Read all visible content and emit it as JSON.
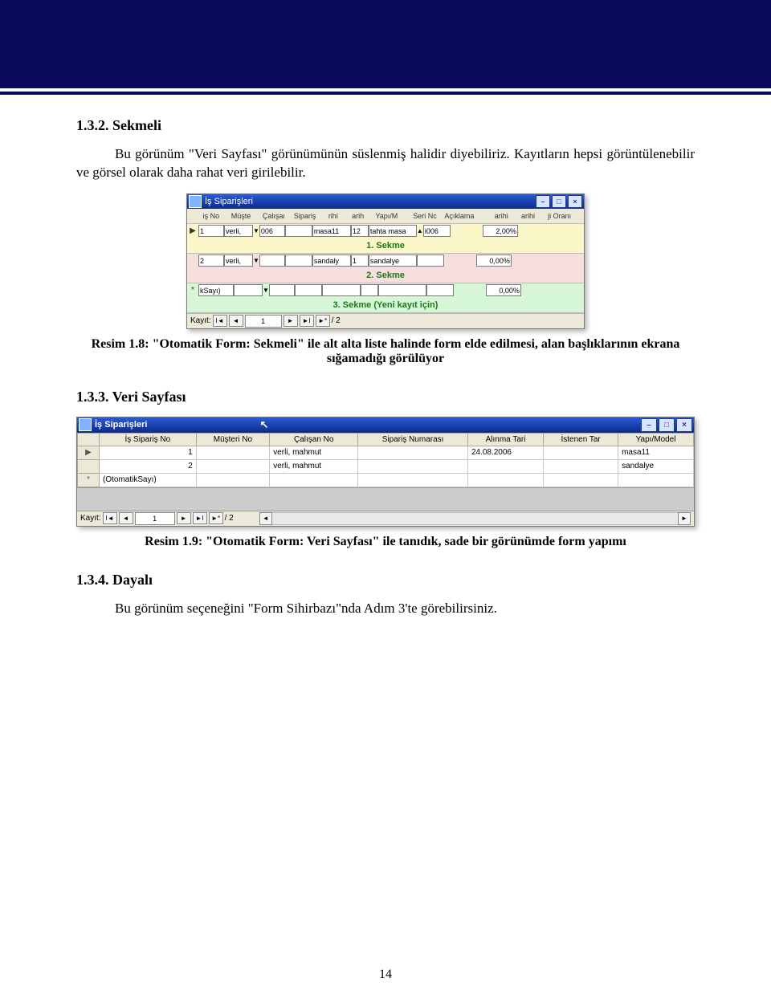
{
  "sections": {
    "s1_num": "1.3.2. Sekmeli",
    "s1_p": "Bu görünüm \"Veri Sayfası\" görünümünün süslenmiş halidir diyebiliriz. Kayıtların hepsi görüntülenebilir ve görsel olarak daha rahat veri girilebilir.",
    "s2_num": "1.3.3. Veri Sayfası",
    "s3_num": "1.3.4. Dayalı",
    "s3_p": "Bu görünüm seçeneğini \"Form Sihirbazı\"nda Adım 3'te görebilirsiniz."
  },
  "fig1": {
    "title": "İş Siparişleri",
    "headers": [
      "iş No",
      "Müşte",
      "Çalışaı",
      "Sipariş",
      "rihi",
      "arih",
      "Yapı/M",
      "Seri Nc",
      "Açıklama",
      "arihi",
      "arihi",
      "ji Oranı"
    ],
    "row1": {
      "mark": "▶",
      "isno": "1",
      "muste": "verli,",
      "calis": "006",
      "siparis": "",
      "yapi": "masa11",
      "seri": "12",
      "acik": "tahta masa",
      "t1": "i006",
      "oran": "2,00%",
      "label": "1. Sekme"
    },
    "row2": {
      "mark": "",
      "isno": "2",
      "muste": "verli,",
      "calis": "",
      "siparis": "",
      "yapi": "sandaly",
      "seri": "1",
      "acik": "sandalye",
      "t1": "",
      "oran": "0,00%",
      "label": "2. Sekme"
    },
    "row3": {
      "mark": "*",
      "isno": "kSayı)",
      "muste": "",
      "calis": "",
      "siparis": "",
      "yapi": "",
      "seri": "",
      "acik": "",
      "t1": "",
      "oran": "0,00%",
      "label": "3. Sekme (Yeni kayıt için)"
    },
    "nav": {
      "label": "Kayıt:",
      "pos": "1",
      "total": "/ 2"
    },
    "caption_b": "Resim 1.8: \"Otomatik Form: Sekmeli\" ile alt alta liste halinde form elde edilmesi, alan başlıklarının ekrana sığamadığı görülüyor"
  },
  "fig2": {
    "title": "İş Siparişleri",
    "cols": [
      "İş Sipariş No",
      "Müşteri No",
      "Çalışan No",
      "Sipariş Numarası",
      "Alınma Tari",
      "İstenen Tar",
      "Yapı/Model"
    ],
    "rows": [
      {
        "mark": "▶",
        "c": [
          "1",
          "",
          "verli, mahmut",
          "",
          "24.08.2006",
          "",
          "masa11"
        ]
      },
      {
        "mark": "",
        "c": [
          "2",
          "",
          "verli, mahmut",
          "",
          "",
          "",
          "sandalye"
        ]
      },
      {
        "mark": "*",
        "c": [
          "(OtomatikSayı)",
          "",
          "",
          "",
          "",
          "",
          ""
        ]
      }
    ],
    "nav": {
      "label": "Kayıt:",
      "pos": "1",
      "total": "/ 2"
    },
    "caption_b": "Resim 1.9: \"Otomatik Form: Veri Sayfası\" ile tanıdık, sade bir görünümde form yapımı"
  },
  "pagenum": "14"
}
